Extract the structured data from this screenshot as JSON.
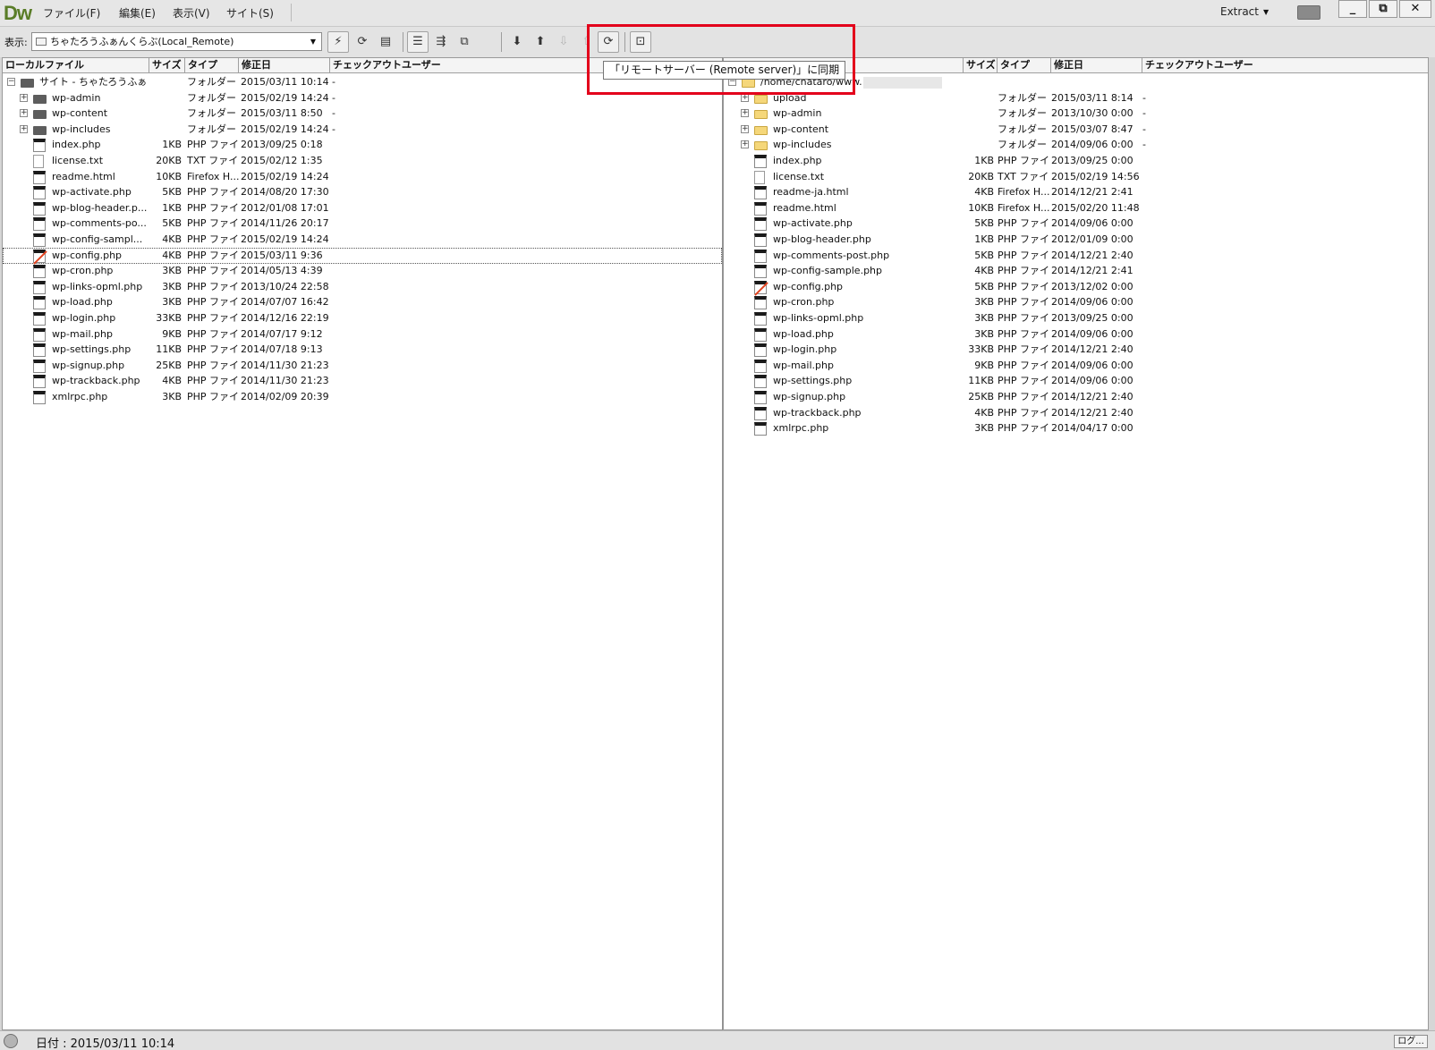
{
  "app": {
    "logo": "Dw",
    "menu": [
      "ファイル(F)",
      "編集(E)",
      "表示(V)",
      "サイト(S)"
    ],
    "workspace": "Extract",
    "window_controls": [
      "_",
      "⧉",
      "✕"
    ]
  },
  "toolbar": {
    "show_label": "表示:",
    "site_value": "ちゃたろうふぁんくらぶ(Local_Remote)",
    "tooltip": "「リモートサーバー (Remote server)」に同期"
  },
  "left_pane": {
    "headers": [
      "ローカルファイル",
      "サイズ",
      "タイプ",
      "修正日",
      "チェックアウトユーザー"
    ],
    "rows": [
      {
        "name": "サイト - ちゃたろうふぁ...",
        "size": "",
        "type": "フォルダー",
        "modified": "2015/03/11 10:14",
        "checkout": "-",
        "kind": "root",
        "expand": "−"
      },
      {
        "name": "wp-admin",
        "size": "",
        "type": "フォルダー",
        "modified": "2015/02/19 14:24",
        "checkout": "-",
        "kind": "folder",
        "expand": "+"
      },
      {
        "name": "wp-content",
        "size": "",
        "type": "フォルダー",
        "modified": "2015/03/11 8:50",
        "checkout": "-",
        "kind": "folder",
        "expand": "+"
      },
      {
        "name": "wp-includes",
        "size": "",
        "type": "フォルダー",
        "modified": "2015/02/19 14:24",
        "checkout": "-",
        "kind": "folder",
        "expand": "+"
      },
      {
        "name": "index.php",
        "size": "1KB",
        "type": "PHP ファイ...",
        "modified": "2013/09/25 0:18",
        "checkout": "",
        "kind": "php"
      },
      {
        "name": "license.txt",
        "size": "20KB",
        "type": "TXT ファイ...",
        "modified": "2015/02/12 1:35",
        "checkout": "",
        "kind": "txt"
      },
      {
        "name": "readme.html",
        "size": "10KB",
        "type": "Firefox H...",
        "modified": "2015/02/19 14:24",
        "checkout": "",
        "kind": "html"
      },
      {
        "name": "wp-activate.php",
        "size": "5KB",
        "type": "PHP ファイ...",
        "modified": "2014/08/20 17:30",
        "checkout": "",
        "kind": "php"
      },
      {
        "name": "wp-blog-header.p...",
        "size": "1KB",
        "type": "PHP ファイ...",
        "modified": "2012/01/08 17:01",
        "checkout": "",
        "kind": "php"
      },
      {
        "name": "wp-comments-po...",
        "size": "5KB",
        "type": "PHP ファイ...",
        "modified": "2014/11/26 20:17",
        "checkout": "",
        "kind": "php"
      },
      {
        "name": "wp-config-sampl...",
        "size": "4KB",
        "type": "PHP ファイ...",
        "modified": "2015/02/19 14:24",
        "checkout": "",
        "kind": "php"
      },
      {
        "name": "wp-config.php",
        "size": "4KB",
        "type": "PHP ファイ...",
        "modified": "2015/03/11 9:36",
        "checkout": "",
        "kind": "php-checked",
        "selected": true
      },
      {
        "name": "wp-cron.php",
        "size": "3KB",
        "type": "PHP ファイ...",
        "modified": "2014/05/13 4:39",
        "checkout": "",
        "kind": "php"
      },
      {
        "name": "wp-links-opml.php",
        "size": "3KB",
        "type": "PHP ファイ...",
        "modified": "2013/10/24 22:58",
        "checkout": "",
        "kind": "php"
      },
      {
        "name": "wp-load.php",
        "size": "3KB",
        "type": "PHP ファイ...",
        "modified": "2014/07/07 16:42",
        "checkout": "",
        "kind": "php"
      },
      {
        "name": "wp-login.php",
        "size": "33KB",
        "type": "PHP ファイ...",
        "modified": "2014/12/16 22:19",
        "checkout": "",
        "kind": "php"
      },
      {
        "name": "wp-mail.php",
        "size": "9KB",
        "type": "PHP ファイ...",
        "modified": "2014/07/17 9:12",
        "checkout": "",
        "kind": "php"
      },
      {
        "name": "wp-settings.php",
        "size": "11KB",
        "type": "PHP ファイ...",
        "modified": "2014/07/18 9:13",
        "checkout": "",
        "kind": "php"
      },
      {
        "name": "wp-signup.php",
        "size": "25KB",
        "type": "PHP ファイ...",
        "modified": "2014/11/30 21:23",
        "checkout": "",
        "kind": "php"
      },
      {
        "name": "wp-trackback.php",
        "size": "4KB",
        "type": "PHP ファイ...",
        "modified": "2014/11/30 21:23",
        "checkout": "",
        "kind": "php"
      },
      {
        "name": "xmlrpc.php",
        "size": "3KB",
        "type": "PHP ファイ...",
        "modified": "2014/02/09 20:39",
        "checkout": "",
        "kind": "php"
      }
    ]
  },
  "right_pane": {
    "headers": [
      "",
      "サイズ",
      "タイプ",
      "修正日",
      "チェックアウトユーザー"
    ],
    "rows": [
      {
        "name": "/home/chataro/www.",
        "size": "",
        "type": "",
        "modified": "",
        "checkout": "",
        "kind": "root",
        "expand": "−"
      },
      {
        "name": "upload",
        "size": "",
        "type": "フォルダー",
        "modified": "2015/03/11 8:14",
        "checkout": "-",
        "kind": "folder",
        "expand": "+"
      },
      {
        "name": "wp-admin",
        "size": "",
        "type": "フォルダー",
        "modified": "2013/10/30 0:00",
        "checkout": "-",
        "kind": "folder",
        "expand": "+"
      },
      {
        "name": "wp-content",
        "size": "",
        "type": "フォルダー",
        "modified": "2015/03/07 8:47",
        "checkout": "-",
        "kind": "folder",
        "expand": "+"
      },
      {
        "name": "wp-includes",
        "size": "",
        "type": "フォルダー",
        "modified": "2014/09/06 0:00",
        "checkout": "-",
        "kind": "folder",
        "expand": "+"
      },
      {
        "name": "index.php",
        "size": "1KB",
        "type": "PHP ファイ...",
        "modified": "2013/09/25 0:00",
        "checkout": "",
        "kind": "php"
      },
      {
        "name": "license.txt",
        "size": "20KB",
        "type": "TXT ファイ...",
        "modified": "2015/02/19 14:56",
        "checkout": "",
        "kind": "txt"
      },
      {
        "name": "readme-ja.html",
        "size": "4KB",
        "type": "Firefox H...",
        "modified": "2014/12/21 2:41",
        "checkout": "",
        "kind": "html"
      },
      {
        "name": "readme.html",
        "size": "10KB",
        "type": "Firefox H...",
        "modified": "2015/02/20 11:48",
        "checkout": "",
        "kind": "html"
      },
      {
        "name": "wp-activate.php",
        "size": "5KB",
        "type": "PHP ファイ...",
        "modified": "2014/09/06 0:00",
        "checkout": "",
        "kind": "php"
      },
      {
        "name": "wp-blog-header.php",
        "size": "1KB",
        "type": "PHP ファイ...",
        "modified": "2012/01/09 0:00",
        "checkout": "",
        "kind": "php"
      },
      {
        "name": "wp-comments-post.php",
        "size": "5KB",
        "type": "PHP ファイ...",
        "modified": "2014/12/21 2:40",
        "checkout": "",
        "kind": "php"
      },
      {
        "name": "wp-config-sample.php",
        "size": "4KB",
        "type": "PHP ファイ...",
        "modified": "2014/12/21 2:41",
        "checkout": "",
        "kind": "php"
      },
      {
        "name": "wp-config.php",
        "size": "5KB",
        "type": "PHP ファイ...",
        "modified": "2013/12/02 0:00",
        "checkout": "",
        "kind": "php-checked"
      },
      {
        "name": "wp-cron.php",
        "size": "3KB",
        "type": "PHP ファイ...",
        "modified": "2014/09/06 0:00",
        "checkout": "",
        "kind": "php"
      },
      {
        "name": "wp-links-opml.php",
        "size": "3KB",
        "type": "PHP ファイ...",
        "modified": "2013/09/25 0:00",
        "checkout": "",
        "kind": "php"
      },
      {
        "name": "wp-load.php",
        "size": "3KB",
        "type": "PHP ファイ...",
        "modified": "2014/09/06 0:00",
        "checkout": "",
        "kind": "php"
      },
      {
        "name": "wp-login.php",
        "size": "33KB",
        "type": "PHP ファイ...",
        "modified": "2014/12/21 2:40",
        "checkout": "",
        "kind": "php"
      },
      {
        "name": "wp-mail.php",
        "size": "9KB",
        "type": "PHP ファイ...",
        "modified": "2014/09/06 0:00",
        "checkout": "",
        "kind": "php"
      },
      {
        "name": "wp-settings.php",
        "size": "11KB",
        "type": "PHP ファイ...",
        "modified": "2014/09/06 0:00",
        "checkout": "",
        "kind": "php"
      },
      {
        "name": "wp-signup.php",
        "size": "25KB",
        "type": "PHP ファイ...",
        "modified": "2014/12/21 2:40",
        "checkout": "",
        "kind": "php"
      },
      {
        "name": "wp-trackback.php",
        "size": "4KB",
        "type": "PHP ファイ...",
        "modified": "2014/12/21 2:40",
        "checkout": "",
        "kind": "php"
      },
      {
        "name": "xmlrpc.php",
        "size": "3KB",
        "type": "PHP ファイ...",
        "modified": "2014/04/17 0:00",
        "checkout": "",
        "kind": "php"
      }
    ]
  },
  "status": {
    "text": "日付 : 2015/03/11 10:14",
    "log_label": "ログ..."
  },
  "colors": {
    "highlight": "#e3001b",
    "logo": "#5a7d28"
  }
}
